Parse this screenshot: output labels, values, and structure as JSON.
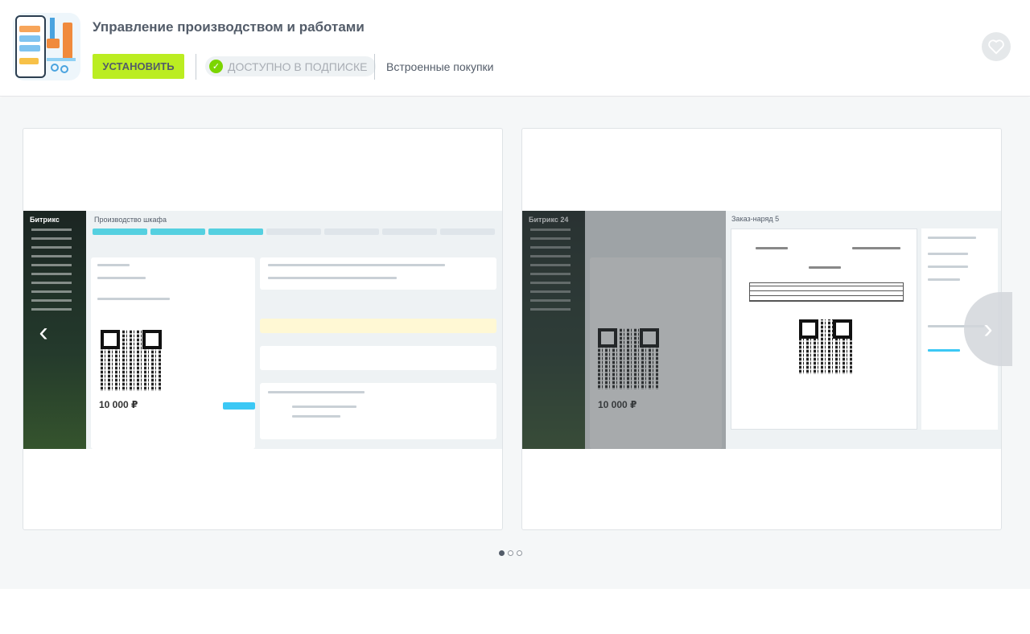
{
  "app": {
    "title": "Управление производством и работами",
    "install_label": "УСТАНОВИТЬ",
    "subscription_label": "ДОСТУПНО В ПОДПИСКЕ",
    "purchases_label": "Встроенные покупки",
    "accent_color": "#bbed21",
    "icon": "app-icon"
  },
  "gallery": {
    "slides": [
      {
        "sidebar_logo": "Битрикс",
        "title": "Производство шкафа",
        "price": "10 000 ₽"
      },
      {
        "sidebar_logo": "Битрикс 24",
        "title": "Заказ-наряд 5",
        "price": "10 000 ₽"
      }
    ],
    "prev_icon": "chevron-left-icon",
    "next_icon": "chevron-right-icon",
    "dot_count": 3,
    "active_dot": 0
  }
}
